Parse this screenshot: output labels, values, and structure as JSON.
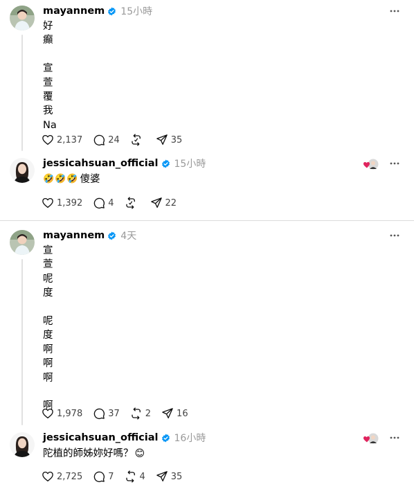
{
  "posts": [
    {
      "username": "mayannem",
      "time": "15小時",
      "text": "好\n癲\n\n宣\n萱\n覆\n我\nNa",
      "likes": "2,137",
      "comments": "24",
      "reposts": "",
      "shares": "35"
    },
    {
      "username": "jessicahsuan_official",
      "time": "15小時",
      "text_emoji": "🤣🤣🤣",
      "text": "傻婆",
      "likes": "1,392",
      "comments": "4",
      "reposts": "",
      "shares": "22"
    },
    {
      "username": "mayannem",
      "time": "4天",
      "text": "宣\n萱\n呢\n度\n\n呢\n度\n啊\n啊\n啊\n\n啊",
      "likes": "1,978",
      "comments": "37",
      "reposts": "2",
      "shares": "16"
    },
    {
      "username": "jessicahsuan_official",
      "time": "16小時",
      "text": "陀植的師姊妳好嗎？",
      "text_emoji": "😊",
      "likes": "2,725",
      "comments": "7",
      "reposts": "4",
      "shares": "35"
    }
  ],
  "colors": {
    "verified": "#0095f6",
    "muted": "#999999",
    "heart_badge": "#e0245e"
  },
  "icons": [
    "heart-icon",
    "comment-icon",
    "repost-icon",
    "share-icon",
    "more-icon",
    "verified-badge-icon"
  ]
}
